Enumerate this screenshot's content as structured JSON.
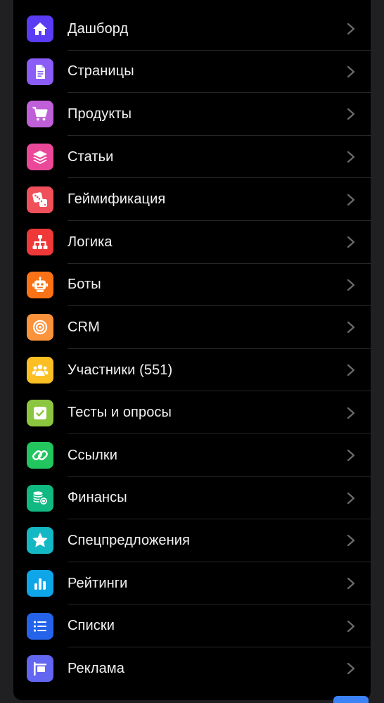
{
  "menu": {
    "items": [
      {
        "label": "Дашборд",
        "icon": "home-icon",
        "color": "#5b3cf5"
      },
      {
        "label": "Страницы",
        "icon": "document-icon",
        "color": "#8b5cf6"
      },
      {
        "label": "Продукты",
        "icon": "cart-icon",
        "color": "#c060d8"
      },
      {
        "label": "Статьи",
        "icon": "layers-icon",
        "color": "#ec4899"
      },
      {
        "label": "Геймификация",
        "icon": "dice-icon",
        "color": "#f0505a"
      },
      {
        "label": "Логика",
        "icon": "sitemap-icon",
        "color": "#ef3838"
      },
      {
        "label": "Боты",
        "icon": "robot-icon",
        "color": "#f97316"
      },
      {
        "label": "CRM",
        "icon": "target-icon",
        "color": "#fb923c"
      },
      {
        "label": "Участники (551)",
        "icon": "users-icon",
        "color": "#fbbf24"
      },
      {
        "label": "Тесты и опросы",
        "icon": "checkbox-icon",
        "color": "#8cc63f"
      },
      {
        "label": "Ссылки",
        "icon": "link-icon",
        "color": "#22c55e"
      },
      {
        "label": "Финансы",
        "icon": "coins-icon",
        "color": "#10b981"
      },
      {
        "label": "Спецпредложения",
        "icon": "star-icon",
        "color": "#14b8c4"
      },
      {
        "label": "Рейтинги",
        "icon": "bar-chart-icon",
        "color": "#0ea5e9"
      },
      {
        "label": "Списки",
        "icon": "list-icon",
        "color": "#2563eb"
      },
      {
        "label": "Реклама",
        "icon": "billboard-icon",
        "color": "#6366f1"
      }
    ]
  }
}
